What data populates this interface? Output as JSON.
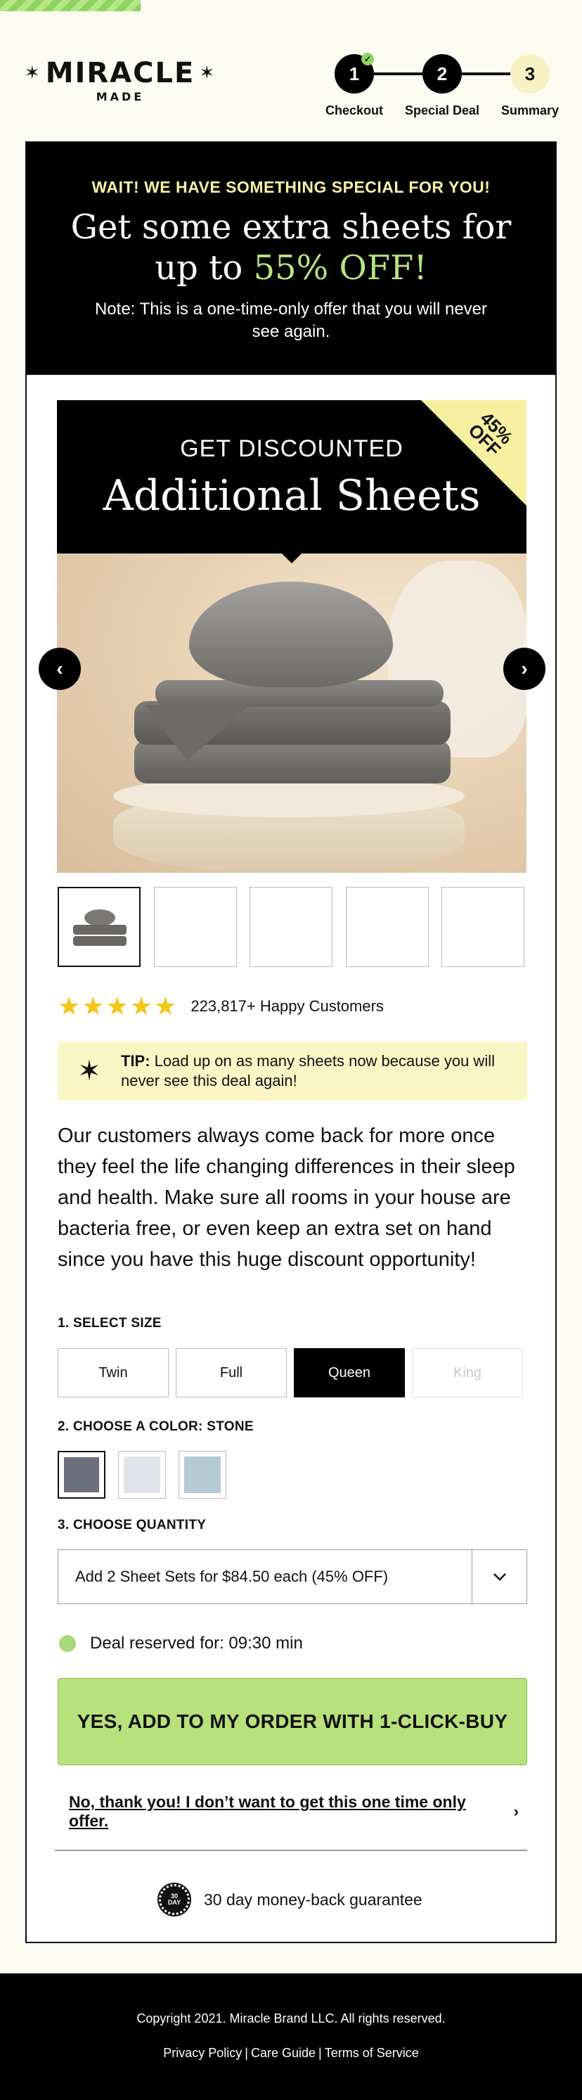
{
  "brand": {
    "name_top": "MIRACLE",
    "name_bottom": "MADE"
  },
  "steps": [
    {
      "number": "1",
      "label": "Checkout",
      "state": "complete"
    },
    {
      "number": "2",
      "label": "Special Deal",
      "state": "current"
    },
    {
      "number": "3",
      "label": "Summary",
      "state": "upcoming"
    }
  ],
  "banner": {
    "kicker": "WAIT! WE HAVE SOMETHING SPECIAL FOR YOU!",
    "headline_line1": "Get some extra sheets for",
    "headline_prefix": "up to ",
    "headline_highlight": "55% OFF!",
    "note": "Note: This is a one-time-only offer that you will never see again."
  },
  "product": {
    "overlay_sub": "GET DISCOUNTED",
    "overlay_title": "Additional Sheets",
    "corner_badge_line1": "45%",
    "corner_badge_line2": "OFF",
    "prev_icon": "‹",
    "next_icon": "›"
  },
  "rating": {
    "stars": "★★★★★",
    "text": "223,817+ Happy Customers"
  },
  "tip": {
    "label": "TIP:",
    "text": " Load up on as many sheets now because you will never see this deal again!"
  },
  "description": "Our customers always come back for more once they feel the life changing differences in their sleep and health. Make sure all rooms in your house are bacteria free, or even keep an extra set on hand since you have this huge discount opportunity!",
  "size": {
    "label": "1. SELECT SIZE",
    "options": [
      {
        "label": "Twin",
        "state": "default"
      },
      {
        "label": "Full",
        "state": "default"
      },
      {
        "label": "Queen",
        "state": "selected"
      },
      {
        "label": "King",
        "state": "disabled"
      }
    ]
  },
  "color": {
    "label": "2. CHOOSE A COLOR: STONE",
    "swatches": [
      {
        "name": "Stone",
        "hex": "#6b6f7e",
        "selected": true
      },
      {
        "name": "White",
        "hex": "#e3e3ea",
        "selected": false
      },
      {
        "name": "Blue",
        "hex": "#b6c9d7",
        "selected": false
      }
    ]
  },
  "quantity": {
    "label": "3. CHOOSE QUANTITY",
    "selected": "Add 2 Sheet Sets for $84.50 each (45% OFF)"
  },
  "reserve": {
    "text": "Deal reserved for: 09:30 min"
  },
  "cta": {
    "label": "YES, ADD TO MY ORDER WITH 1-CLICK-BUY"
  },
  "decline": {
    "label": "No, thank you! I don’t want to get this one time only offer.",
    "arrow": "›"
  },
  "guarantee": {
    "badge_line1": "30",
    "badge_line2": "DAY",
    "text": "30 day money-back guarantee"
  },
  "footer": {
    "copyright": "Copyright 2021. Miracle Brand LLC. All rights reserved.",
    "links": [
      "Privacy Policy",
      "Care Guide",
      "Terms of Service"
    ]
  },
  "colors": {
    "accent_green": "#b7e27b",
    "highlight_green": "#b6e37f",
    "kicker_yellow": "#f6f1a4",
    "tip_bg": "#fbf6c6",
    "star_gold": "#f5c518"
  }
}
